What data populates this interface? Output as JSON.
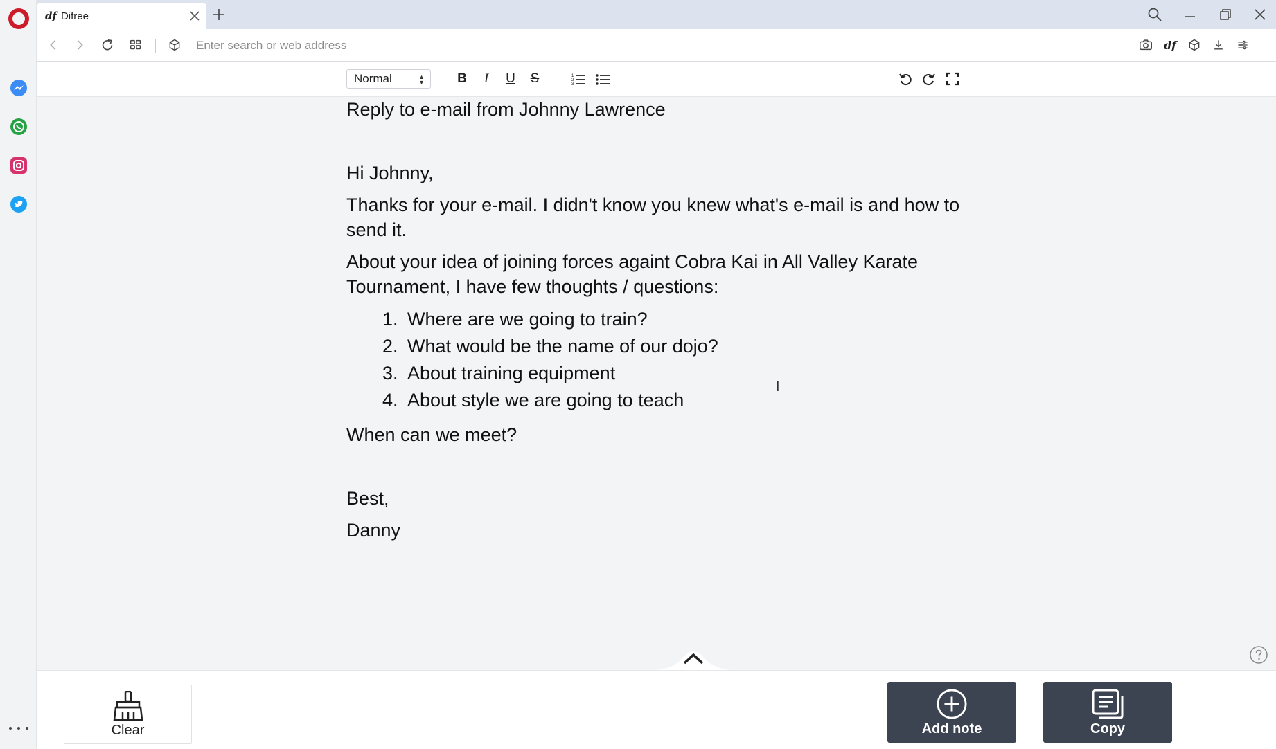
{
  "browser": {
    "tab": {
      "favicon": "df",
      "title": "Difree"
    },
    "address_placeholder": "Enter search or web address",
    "toolbar_badge": "df"
  },
  "sidebar": {
    "items": [
      {
        "name": "messenger",
        "color": "#3b8cf5"
      },
      {
        "name": "whatsapp",
        "color": "#25a244"
      },
      {
        "name": "instagram",
        "color": "#e1306c"
      },
      {
        "name": "twitter",
        "color": "#1da1f2"
      }
    ]
  },
  "editor_toolbar": {
    "format_value": "Normal"
  },
  "document": {
    "subject": "Reply to e-mail from Johnny Lawrence",
    "greeting": "Hi Johnny,",
    "para1": "Thanks for your e-mail. I didn't know you knew what's e-mail is and how to send it.",
    "para2": "About your idea of joining forces againt Cobra Kai in All Valley Karate Tournament, I have few thoughts / questions:",
    "list": [
      "Where are we going to train?",
      "What would be the name of our dojo?",
      "About training equipment",
      "About style we are going to teach"
    ],
    "question": "When can we meet?",
    "closing": "Best,",
    "signature": "Danny"
  },
  "actions": {
    "clear_label": "Clear",
    "add_note_label": "Add note",
    "copy_label": "Copy"
  },
  "colors": {
    "opera_red": "#cc1c2a",
    "dark_button": "#3c4451",
    "content_bg": "#f3f4f6"
  }
}
